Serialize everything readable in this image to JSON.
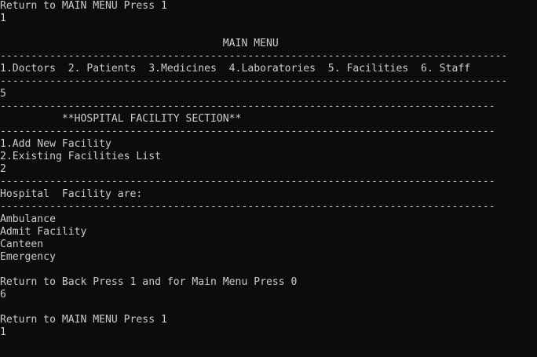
{
  "console": {
    "lines": [
      "Return to MAIN MENU Press 1",
      "1",
      "",
      "                                    MAIN MENU",
      "----------------------------------------------------------------------------------",
      "1.Doctors  2. Patients  3.Medicines  4.Laboratories  5. Facilities  6. Staff",
      "----------------------------------------------------------------------------------",
      "5",
      "--------------------------------------------------------------------------------",
      "          **HOSPITAL FACILITY SECTION**",
      "--------------------------------------------------------------------------------",
      "1.Add New Facility",
      "2.Existing Facilities List",
      "2",
      "--------------------------------------------------------------------------------",
      "Hospital  Facility are:",
      "--------------------------------------------------------------------------------",
      "Ambulance",
      "Admit Facility",
      "Canteen",
      "Emergency",
      "",
      "Return to Back Press 1 and for Main Menu Press 0",
      "6",
      "",
      "Return to MAIN MENU Press 1",
      "1"
    ]
  }
}
